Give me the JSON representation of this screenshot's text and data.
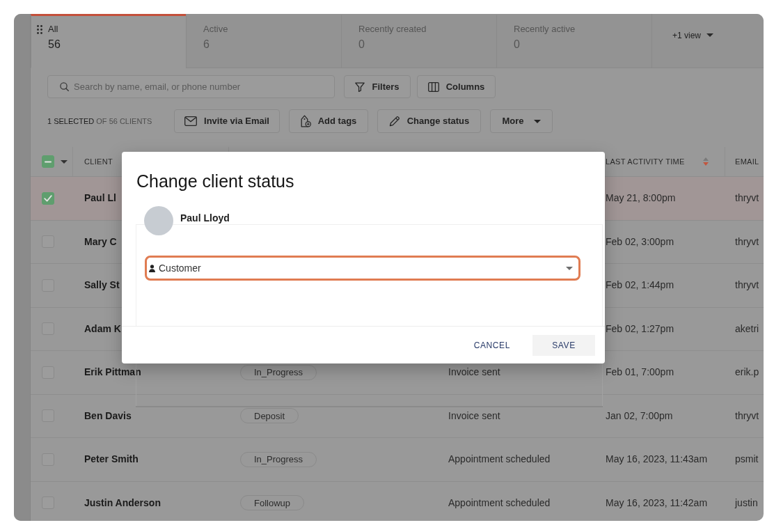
{
  "tabs": [
    {
      "label": "All",
      "count": "56",
      "selected": true
    },
    {
      "label": "Active",
      "count": "6",
      "selected": false
    },
    {
      "label": "Recently created",
      "count": "0",
      "selected": false
    },
    {
      "label": "Recently active",
      "count": "0",
      "selected": false
    }
  ],
  "more_views": {
    "label": "+1 view"
  },
  "search": {
    "placeholder": "Search by name, email, or phone number"
  },
  "filters_button": {
    "label": "Filters"
  },
  "columns_button": {
    "label": "Columns"
  },
  "selection_summary": "**1 SELECTED** OF 56 CLIENTS",
  "bulk_actions": [
    {
      "label": "Invite via Email"
    },
    {
      "label": "Add tags"
    },
    {
      "label": "Change status"
    }
  ],
  "more_button": {
    "label": "More"
  },
  "table": {
    "select_all": {
      "indeterminate": true
    },
    "columns": [
      {
        "label": "CLIENT"
      },
      {
        "label": "LAST ACTIVITY TIME",
        "sorted_descending": true
      },
      {
        "label": "EMAIL"
      }
    ],
    "rows": [
      {
        "selected": true,
        "client": "Paul Ll",
        "last_activity_time": "May 21, 8:00pm",
        "email": "thryvt"
      },
      {
        "selected": false,
        "client": "Mary C",
        "last_activity_time": "Feb 02, 3:00pm",
        "email": "thryvt"
      },
      {
        "selected": false,
        "client": "Sally St",
        "last_activity_time": "Feb 02, 1:44pm",
        "email": "thryvt"
      },
      {
        "selected": false,
        "client": "Adam K",
        "last_activity_time": "Feb 02, 1:27pm",
        "email": "aketri"
      },
      {
        "selected": false,
        "client": "Erik Pittman",
        "column_2": "In_Progress",
        "column_3": "Invoice sent",
        "last_activity_time": "Feb 01, 7:00pm",
        "email": "erik.p"
      },
      {
        "selected": false,
        "client": "Ben Davis",
        "column_2": "Deposit",
        "column_3": "Invoice sent",
        "last_activity_time": "Jan 02, 7:00pm",
        "email": "thryvt"
      },
      {
        "selected": false,
        "client": "Peter Smith",
        "column_2": "In_Progress",
        "column_3": "Appointment scheduled",
        "last_activity_time": "May 16, 2023, 11:43am",
        "email": "psmit"
      },
      {
        "selected": false,
        "client": "Justin Anderson",
        "column_2": "Followup",
        "column_3": "Appointment scheduled",
        "last_activity_time": "May 16, 2023, 11:42am",
        "email": "justin"
      }
    ]
  },
  "dialog": {
    "title": "Change client status",
    "client": {
      "name": "Paul Lloyd"
    },
    "status_select": {
      "value": "Customer",
      "focused": true
    },
    "cancel_button": {
      "label": "CANCEL"
    },
    "save_button": {
      "label": "SAVE"
    }
  }
}
